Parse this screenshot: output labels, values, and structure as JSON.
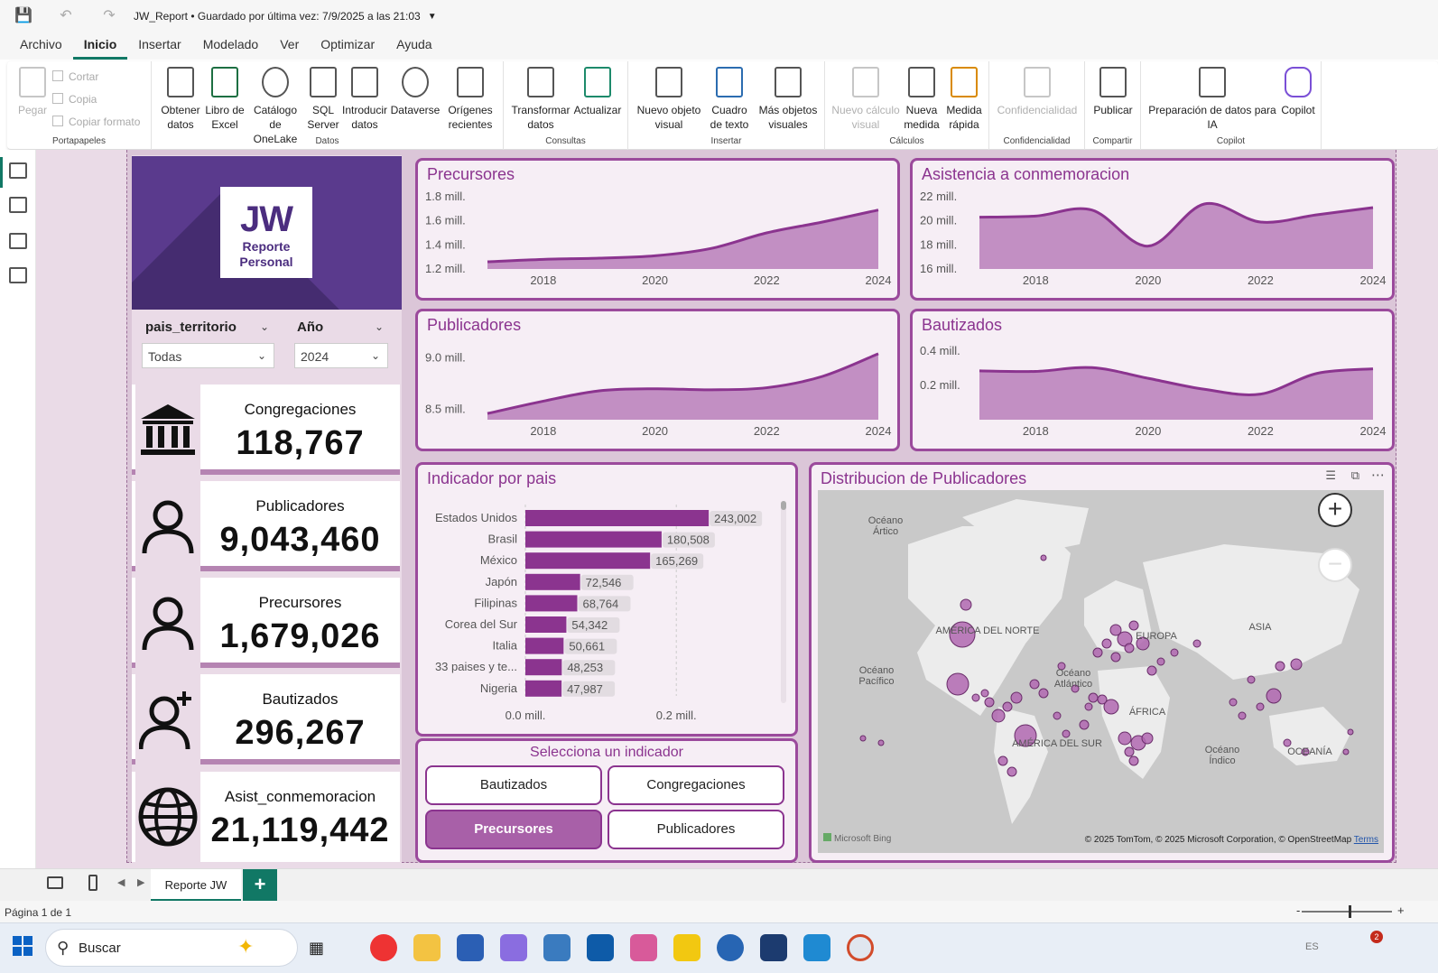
{
  "titlebar": {
    "title": "JW_Report • Guardado por última vez: 7/9/2025 a las 21:03"
  },
  "menu": [
    "Archivo",
    "Inicio",
    "Insertar",
    "Modelado",
    "Ver",
    "Optimizar",
    "Ayuda"
  ],
  "ribbon": {
    "portapapeles": {
      "pegar": "Pegar",
      "cortar": "Cortar",
      "copia": "Copia",
      "copiar_formato": "Copiar formato",
      "label": "Portapapeles"
    },
    "datos": {
      "label": "Datos",
      "items": [
        "Obtener datos",
        "Libro de Excel",
        "Catálogo de OneLake",
        "SQL Server",
        "Introducir datos",
        "Dataverse",
        "Orígenes recientes"
      ]
    },
    "consultas": {
      "label": "Consultas",
      "items": [
        "Transformar datos",
        "Actualizar"
      ]
    },
    "insertar": {
      "label": "Insertar",
      "items": [
        "Nuevo objeto visual",
        "Cuadro de texto",
        "Más objetos visuales"
      ]
    },
    "calculos": {
      "label": "Cálculos",
      "items": [
        "Nuevo cálculo visual",
        "Nueva medida",
        "Medida rápida"
      ]
    },
    "confidencialidad": {
      "label": "Confidencialidad",
      "items": [
        "Confidencialidad"
      ]
    },
    "compartir": {
      "label": "Compartir",
      "items": [
        "Publicar"
      ]
    },
    "copilot": {
      "label": "Copilot",
      "items": [
        "Preparación de datos para IA",
        "Copilot"
      ]
    }
  },
  "logo": {
    "big": "JW",
    "line1": "Reporte",
    "line2": "Personal"
  },
  "slicers": {
    "pais": {
      "label": "pais_territorio",
      "value": "Todas"
    },
    "anio": {
      "label": "Año",
      "value": "2024"
    }
  },
  "kpis": [
    {
      "label": "Congregaciones",
      "value": "118,767",
      "icon": "building-icon"
    },
    {
      "label": "Publicadores",
      "value": "9,043,460",
      "icon": "person-icon"
    },
    {
      "label": "Precursores",
      "value": "1,679,026",
      "icon": "person-icon"
    },
    {
      "label": "Bautizados",
      "value": "296,267",
      "icon": "person-add-icon"
    },
    {
      "label": "Asist_conmemoracion",
      "value": "21,119,442",
      "icon": "globe-icon"
    }
  ],
  "charts": {
    "precursores": {
      "title": "Precursores"
    },
    "asistencia": {
      "title": "Asistencia a conmemoracion"
    },
    "publicadores": {
      "title": "Publicadores"
    },
    "bautizados": {
      "title": "Bautizados"
    },
    "indicador": {
      "title": "Indicador por pais"
    },
    "mapa": {
      "title": "Distribucion de Publicadores"
    }
  },
  "chart_data": [
    {
      "type": "area",
      "title": "Precursores",
      "x": [
        2017,
        2018,
        2019,
        2020,
        2021,
        2022,
        2023,
        2024
      ],
      "y": [
        1.26,
        1.28,
        1.29,
        1.31,
        1.37,
        1.5,
        1.59,
        1.69
      ],
      "x_ticks": [
        "2018",
        "2020",
        "2022",
        "2024"
      ],
      "y_ticks": [
        "1.2 mill.",
        "1.4 mill.",
        "1.6 mill.",
        "1.8 mill."
      ],
      "ylim": [
        1.2,
        1.8
      ]
    },
    {
      "type": "area",
      "title": "Asistencia a conmemoracion",
      "x": [
        2017,
        2018,
        2019,
        2020,
        2021,
        2022,
        2023,
        2024
      ],
      "y": [
        20.3,
        20.4,
        20.9,
        17.9,
        21.4,
        19.9,
        20.5,
        21.1
      ],
      "x_ticks": [
        "2018",
        "2020",
        "2022",
        "2024"
      ],
      "y_ticks": [
        "16 mill.",
        "18 mill.",
        "20 mill.",
        "22 mill."
      ],
      "ylim": [
        16,
        22
      ]
    },
    {
      "type": "area",
      "title": "Publicadores",
      "x": [
        2017,
        2018,
        2019,
        2020,
        2021,
        2022,
        2023,
        2024
      ],
      "y": [
        8.46,
        8.58,
        8.68,
        8.7,
        8.69,
        8.71,
        8.82,
        9.04
      ],
      "x_ticks": [
        "2018",
        "2020",
        "2022",
        "2024"
      ],
      "y_ticks": [
        "8.5 mill.",
        "9.0 mill."
      ],
      "ylim": [
        8.4,
        9.1
      ]
    },
    {
      "type": "area",
      "title": "Bautizados",
      "x": [
        2017,
        2018,
        2019,
        2020,
        2021,
        2022,
        2023,
        2024
      ],
      "y": [
        0.284,
        0.281,
        0.303,
        0.241,
        0.177,
        0.149,
        0.269,
        0.296
      ],
      "x_ticks": [
        "2018",
        "2020",
        "2022",
        "2024"
      ],
      "y_ticks": [
        "0.2 mill.",
        "0.4 mill."
      ],
      "ylim": [
        0.0,
        0.42
      ]
    },
    {
      "type": "bar",
      "title": "Indicador por pais",
      "categories": [
        "Estados Unidos",
        "Brasil",
        "México",
        "Japón",
        "Filipinas",
        "Corea del Sur",
        "Italia",
        "33 paises y te...",
        "Nigeria"
      ],
      "values": [
        243002,
        180508,
        165269,
        72546,
        68764,
        54342,
        50661,
        48253,
        47987
      ],
      "labels": [
        "243,002",
        "180,508",
        "165,269",
        "72,546",
        "68,764",
        "54,342",
        "50,661",
        "48,253",
        "47,987"
      ],
      "x_ticks": [
        "0.0 mill.",
        "0.2 mill."
      ],
      "xlim": [
        0,
        0.3
      ]
    }
  ],
  "selector": {
    "title": "Selecciona un indicador",
    "options": [
      "Bautizados",
      "Congregaciones",
      "Precursores",
      "Publicadores"
    ],
    "selected": "Precursores"
  },
  "map": {
    "labels": {
      "artico": "Océano Ártico",
      "norte": "AMÉRICA DEL NORTE",
      "europa": "EUROPA",
      "asia": "ASIA",
      "pacifico": "Océano Pacífico",
      "atlantico": "Océano Atlántico",
      "africa": "ÁFRICA",
      "sur": "AMÉRICA DEL SUR",
      "indico": "Océano Índico",
      "oceania": "OCEANÍA"
    },
    "attribution": "© 2025 TomTom, © 2025 Microsoft Corporation, © OpenStreetMap",
    "terms": "Terms",
    "bing": "Microsoft Bing"
  },
  "pages": {
    "tab": "Reporte JW",
    "add": "+"
  },
  "status": {
    "page": "Página 1 de 1"
  },
  "taskbar": {
    "search": "Buscar",
    "lang": "ES",
    "badge": "2"
  },
  "colors": {
    "accent": "#8b348f",
    "fill": "#c28fc3",
    "canvas": "#eadbe7",
    "logo_bg": "#5a3a8d"
  }
}
